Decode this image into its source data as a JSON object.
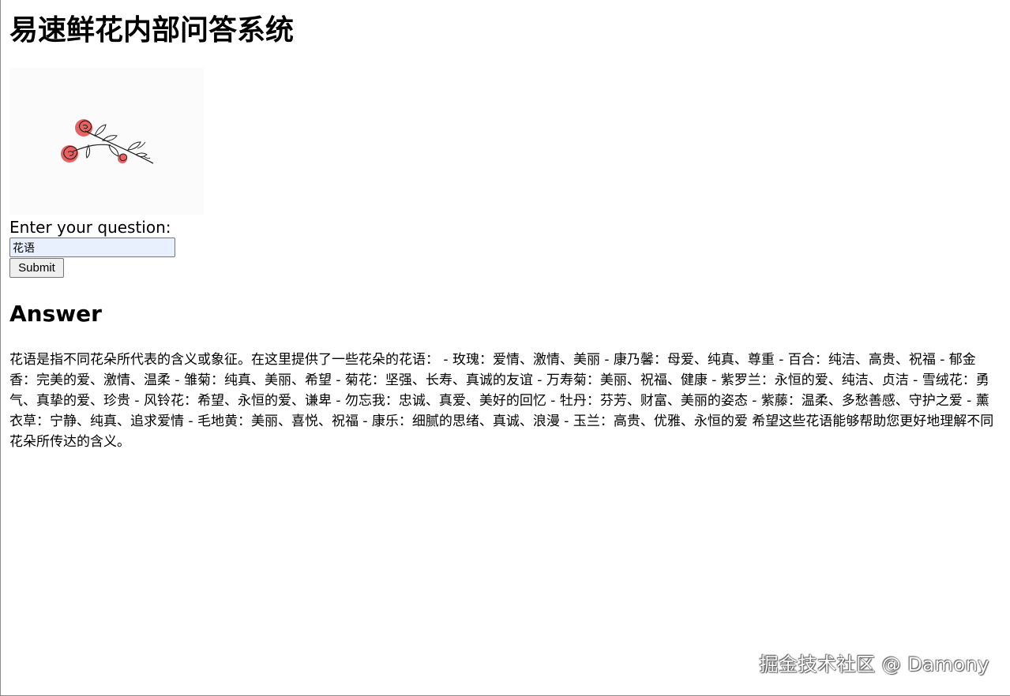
{
  "header": {
    "title": "易速鲜花内部问答系统"
  },
  "image": {
    "icon": "rose-illustration",
    "colors": {
      "bloom": "#e84545",
      "stem": "#222222"
    }
  },
  "form": {
    "label": "Enter your question:",
    "input_value": "花语",
    "submit_label": "Submit"
  },
  "answer": {
    "heading": "Answer",
    "text": "花语是指不同花朵所代表的含义或象征。在这里提供了一些花朵的花语： - 玫瑰：爱情、激情、美丽 - 康乃馨：母爱、纯真、尊重 - 百合：纯洁、高贵、祝福 - 郁金香：完美的爱、激情、温柔 - 雏菊：纯真、美丽、希望 - 菊花：坚强、长寿、真诚的友谊 - 万寿菊：美丽、祝福、健康 - 紫罗兰：永恒的爱、纯洁、贞洁 - 雪绒花：勇气、真挚的爱、珍贵 - 风铃花：希望、永恒的爱、谦卑 - 勿忘我：忠诚、真爱、美好的回忆 - 牡丹：芬芳、财富、美丽的姿态 - 紫藤：温柔、多愁善感、守护之爱 - 薰衣草：宁静、纯真、追求爱情 - 毛地黄：美丽、喜悦、祝福 - 康乐：细腻的思绪、真诚、浪漫 - 玉兰：高贵、优雅、永恒的爱 希望这些花语能够帮助您更好地理解不同花朵所传达的含义。"
  },
  "watermark": {
    "text": "掘金技术社区 @ Damony"
  }
}
